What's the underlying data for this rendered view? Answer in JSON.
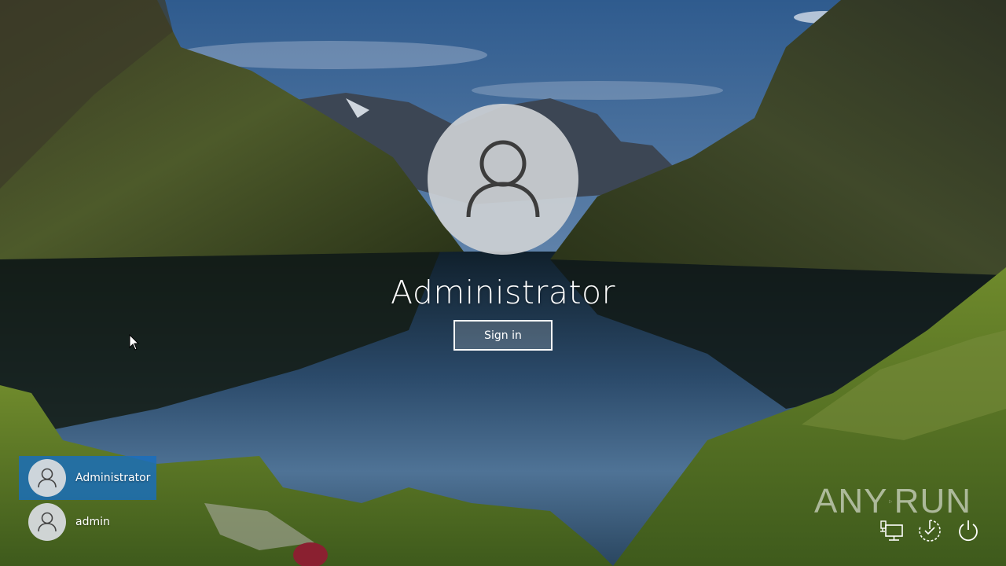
{
  "lock_screen": {
    "username": "Administrator",
    "signin_label": "Sign in"
  },
  "user_list": [
    {
      "name": "Administrator",
      "selected": true
    },
    {
      "name": "admin",
      "selected": false
    }
  ],
  "watermark": {
    "left_text": "ANY",
    "right_text": "RUN"
  },
  "tray": {
    "icons": [
      "network-icon",
      "ease-of-access-icon",
      "power-icon"
    ]
  },
  "colors": {
    "selected_tile": "#186EBE",
    "avatar_bg": "#CDD0D4"
  }
}
